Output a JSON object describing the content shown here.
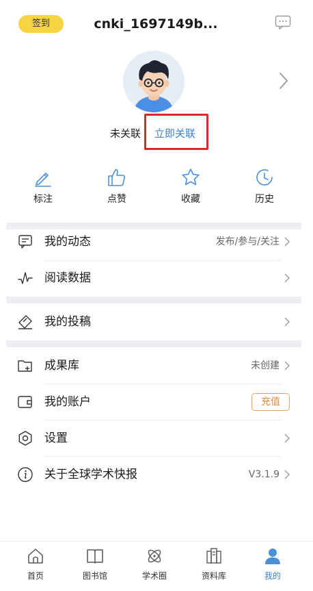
{
  "header": {
    "signin_label": "签到",
    "username": "cnki_1697149b...",
    "message_icon": "message-icon"
  },
  "profile": {
    "link_status": "未关联",
    "link_action": "立即关联"
  },
  "quick_actions": [
    {
      "label": "标注",
      "icon": "pencil-icon"
    },
    {
      "label": "点赞",
      "icon": "thumbs-up-icon"
    },
    {
      "label": "收藏",
      "icon": "star-icon"
    },
    {
      "label": "历史",
      "icon": "history-icon"
    }
  ],
  "menu": {
    "my_activity": {
      "label": "我的动态",
      "value": "发布/参与/关注"
    },
    "reading_data": {
      "label": "阅读数据"
    },
    "my_submissions": {
      "label": "我的投稿"
    },
    "results_library": {
      "label": "成果库",
      "value": "未创建"
    },
    "my_account": {
      "label": "我的账户",
      "action": "充值"
    },
    "settings": {
      "label": "设置"
    },
    "about": {
      "label": "关于全球学术快报",
      "value": "V3.1.9"
    }
  },
  "tabbar": {
    "items": [
      {
        "label": "首页",
        "icon": "home-icon"
      },
      {
        "label": "图书馆",
        "icon": "book-icon"
      },
      {
        "label": "学术圈",
        "icon": "atom-icon"
      },
      {
        "label": "资料库",
        "icon": "library-icon"
      },
      {
        "label": "我的",
        "icon": "user-icon",
        "active": true
      }
    ]
  },
  "colors": {
    "accent": "#3b82c4",
    "signin_bg": "#f6d443",
    "highlight_border": "#e0262a",
    "recharge": "#e08a3e"
  }
}
